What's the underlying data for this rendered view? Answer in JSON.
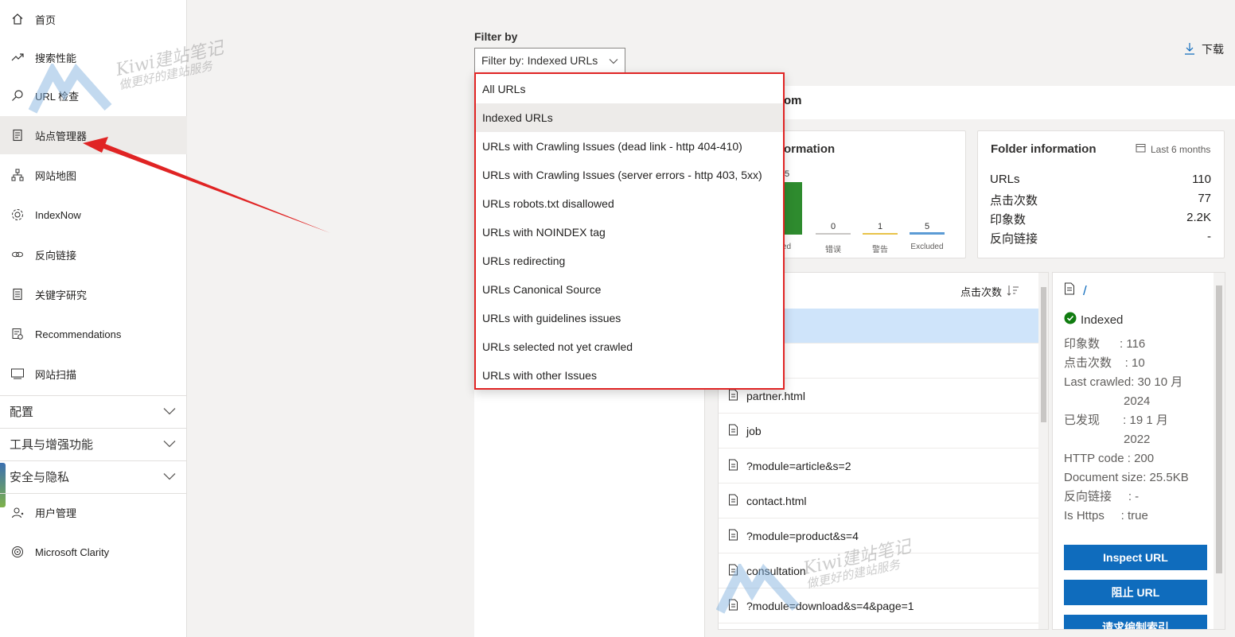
{
  "sidebar": {
    "items": [
      {
        "label": "首页",
        "icon": "home-icon"
      },
      {
        "label": "搜索性能",
        "icon": "trend-icon"
      },
      {
        "label": "URL 检查",
        "icon": "search-icon"
      },
      {
        "label": "站点管理器",
        "icon": "document-icon",
        "active": true
      },
      {
        "label": "网站地图",
        "icon": "sitemap-icon"
      },
      {
        "label": "IndexNow",
        "icon": "gear-icon"
      },
      {
        "label": "反向链接",
        "icon": "link-icon"
      },
      {
        "label": "关键字研究",
        "icon": "document-icon"
      },
      {
        "label": "Recommendations",
        "icon": "recommend-icon"
      },
      {
        "label": "网站扫描",
        "icon": "scan-icon"
      }
    ],
    "groups": [
      {
        "label": "配置"
      },
      {
        "label": "工具与增强功能"
      },
      {
        "label": "安全与隐私"
      }
    ],
    "bottom_items": [
      {
        "label": "用户管理",
        "icon": "user-icon"
      },
      {
        "label": "Microsoft Clarity",
        "icon": "clarity-icon"
      }
    ]
  },
  "filter": {
    "label": "Filter by",
    "selected": "Filter by: Indexed URLs",
    "options": [
      "All URLs",
      "Indexed URLs",
      "URLs with Crawling Issues (dead link - http 404-410)",
      "URLs with Crawling Issues (server errors - http 403, 5xx)",
      "URLs robots.txt disallowed",
      "URLs with NOINDEX tag",
      "URLs redirecting",
      "URLs Canonical Source",
      "URLs with guidelines issues",
      "URLs selected not yet crawled",
      "URLs with other Issues"
    ],
    "selected_index": 1
  },
  "toolbar": {
    "download_label": "下载"
  },
  "site": {
    "title_fragment": "om"
  },
  "url_info_card": {
    "title_fragment": "ormation",
    "chart_data": {
      "type": "bar",
      "categories": [
        "xed",
        "错误",
        "警告",
        "Excluded"
      ],
      "values": [
        105,
        0,
        1,
        5
      ],
      "count_labels": [
        "05",
        "0",
        "1",
        "5"
      ],
      "colors": [
        "#2e8b2e",
        "#c8c6c4",
        "#e8c34a",
        "#5b9bd5"
      ]
    }
  },
  "folder_card": {
    "title": "Folder information",
    "period": "Last 6 months",
    "rows": [
      {
        "label": "URLs",
        "value": "110"
      },
      {
        "label": "点击次数",
        "value": "77"
      },
      {
        "label": "印象数",
        "value": "2.2K"
      },
      {
        "label": "反向链接",
        "value": "-"
      }
    ]
  },
  "url_list": {
    "sort_label": "点击次数",
    "rows": [
      {
        "text": "",
        "selected": true
      },
      {
        "text": "tml"
      },
      {
        "text": "partner.html"
      },
      {
        "text": "job"
      },
      {
        "text": "?module=article&s=2"
      },
      {
        "text": "contact.html"
      },
      {
        "text": "?module=product&s=4"
      },
      {
        "text": "consultation"
      },
      {
        "text": "?module=download&s=4&page=1"
      }
    ]
  },
  "detail": {
    "path": "/",
    "status": "Indexed",
    "rows": [
      {
        "text": "印象数      : 116"
      },
      {
        "text": "点击次数    : 10"
      },
      {
        "text": "Last crawled: 30 10 月"
      },
      {
        "text": "                  2024"
      },
      {
        "text": "已发现       : 19 1 月"
      },
      {
        "text": "                  2022"
      },
      {
        "text": "HTTP code : 200"
      },
      {
        "text": "Document size: 25.5KB"
      },
      {
        "text": "反向链接     : -"
      },
      {
        "text": "Is Https     : true"
      }
    ],
    "buttons": [
      "Inspect URL",
      "阻止 URL",
      "请求编制索引"
    ]
  },
  "watermark": {
    "brand": "Kiwi建站笔记",
    "slogan": "做更好的建站服务"
  },
  "colors": {
    "accent": "#0f6cbd",
    "highlight_border": "#e02424",
    "indexed_green": "#107c10"
  }
}
